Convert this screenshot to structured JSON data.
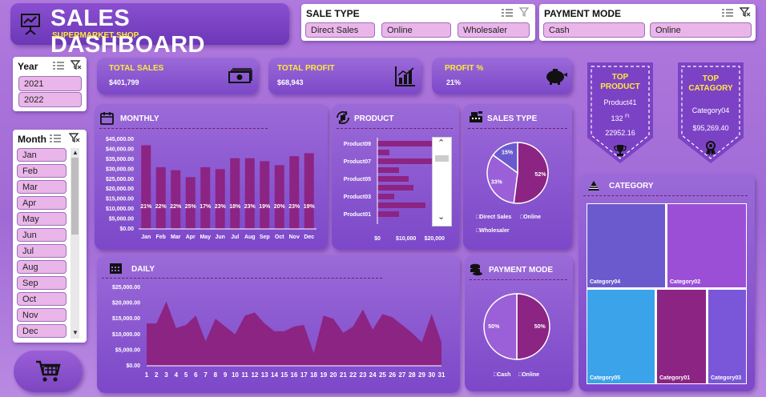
{
  "header": {
    "title": "SALES DASHBOARD",
    "subtitle": "SUPERMARKET SHOP"
  },
  "filters": {
    "sale_type": {
      "label": "SALE TYPE",
      "options": [
        "Direct Sales",
        "Online",
        "Wholesaler"
      ]
    },
    "payment_mode": {
      "label": "PAYMENT MODE",
      "options": [
        "Cash",
        "Online"
      ]
    },
    "year": {
      "label": "Year",
      "options": [
        "2021",
        "2022"
      ]
    },
    "month": {
      "label": "Month",
      "options": [
        "Jan",
        "Feb",
        "Mar",
        "Apr",
        "May",
        "Jun",
        "Jul",
        "Aug",
        "Sep",
        "Oct",
        "Nov",
        "Dec"
      ]
    }
  },
  "kpis": {
    "total_sales": {
      "label": "TOTAL SALES",
      "value": "$401,799"
    },
    "total_profit": {
      "label": "TOTAL PROFIT",
      "value": "$68,943"
    },
    "profit_pct": {
      "label": "PROFIT %",
      "value": "21%"
    }
  },
  "top_product": {
    "title_line1": "TOP",
    "title_line2": "PRODUCT",
    "name": "Product41",
    "qty": "132",
    "unit": "Ft",
    "amount": "22952.16"
  },
  "top_category": {
    "title_line1": "TOP",
    "title_line2": "CATAGORY",
    "name": "Category04",
    "amount": "$95,269.40"
  },
  "colors": {
    "accent": "#8c2484",
    "card": "#8a58cf",
    "yellow": "#ffe93b",
    "bar": "#8c2484"
  },
  "chart_data": [
    {
      "id": "monthly",
      "type": "bar",
      "title": "MONTHLY",
      "categories": [
        "Jan",
        "Feb",
        "Mar",
        "Apr",
        "May",
        "Jun",
        "Jul",
        "Aug",
        "Sep",
        "Oct",
        "Nov",
        "Dec"
      ],
      "values": [
        42000,
        31000,
        29500,
        26000,
        31000,
        30000,
        35500,
        35500,
        34000,
        32000,
        36500,
        38000
      ],
      "labels": [
        "21%",
        "22%",
        "22%",
        "25%",
        "17%",
        "23%",
        "18%",
        "23%",
        "19%",
        "20%",
        "23%",
        "19%"
      ],
      "yticks": [
        "$0.00",
        "$5,000.00",
        "$10,000.00",
        "$15,000.00",
        "$20,000.00",
        "$25,000.00",
        "$30,000.00",
        "$35,000.00",
        "$40,000.00",
        "$45,000.00"
      ],
      "ylim": [
        0,
        45000
      ]
    },
    {
      "id": "product",
      "type": "bar",
      "title": "PRODUCT",
      "orientation": "horizontal",
      "categories": [
        "Product09",
        "Product07",
        "Product05",
        "Product03",
        "Product01"
      ],
      "values": [
        24000,
        5000,
        24000,
        9000,
        13000,
        15000,
        7000,
        20000,
        9000
      ],
      "xticks": [
        "$0",
        "$10,000",
        "$20,000"
      ],
      "xlim": [
        0,
        22000
      ]
    },
    {
      "id": "sales_type",
      "type": "pie",
      "title": "SALES TYPE",
      "series": [
        {
          "name": "Direct Sales",
          "value": 52,
          "label": "52%"
        },
        {
          "name": "Online",
          "value": 33,
          "label": "33%"
        },
        {
          "name": "Wholesaler",
          "value": 15,
          "label": "15%"
        }
      ]
    },
    {
      "id": "payment_mode",
      "type": "pie",
      "title": "PAYMENT MODE",
      "series": [
        {
          "name": "Cash",
          "value": 50,
          "label": "50%"
        },
        {
          "name": "Online",
          "value": 50,
          "label": "50%"
        }
      ]
    },
    {
      "id": "daily",
      "type": "area",
      "title": "DAILY",
      "x": [
        1,
        2,
        3,
        4,
        5,
        6,
        7,
        8,
        9,
        10,
        11,
        12,
        13,
        14,
        15,
        16,
        17,
        18,
        19,
        20,
        21,
        22,
        23,
        24,
        25,
        26,
        27,
        28,
        29,
        30,
        31
      ],
      "values": [
        13500,
        13500,
        20500,
        12000,
        13000,
        16000,
        7800,
        15000,
        12500,
        10000,
        16000,
        17000,
        13500,
        11000,
        11000,
        12500,
        13000,
        4000,
        16000,
        15000,
        10500,
        12500,
        18000,
        11500,
        16500,
        15500,
        13000,
        10500,
        7500,
        16500,
        7500
      ],
      "yticks": [
        "$0.00",
        "$5,000.00",
        "$10,000.00",
        "$15,000.00",
        "$20,000.00",
        "$25,000.00"
      ],
      "ylim": [
        0,
        25000
      ]
    },
    {
      "id": "category",
      "type": "treemap",
      "title": "CATEGORY",
      "series": [
        {
          "name": "Category04",
          "color": "#6a5acd"
        },
        {
          "name": "Category02",
          "color": "#9b4fd6"
        },
        {
          "name": "Category05",
          "color": "#3aa3ea"
        },
        {
          "name": "Category01",
          "color": "#8c2484"
        },
        {
          "name": "Category03",
          "color": "#7a57d8"
        }
      ]
    }
  ]
}
